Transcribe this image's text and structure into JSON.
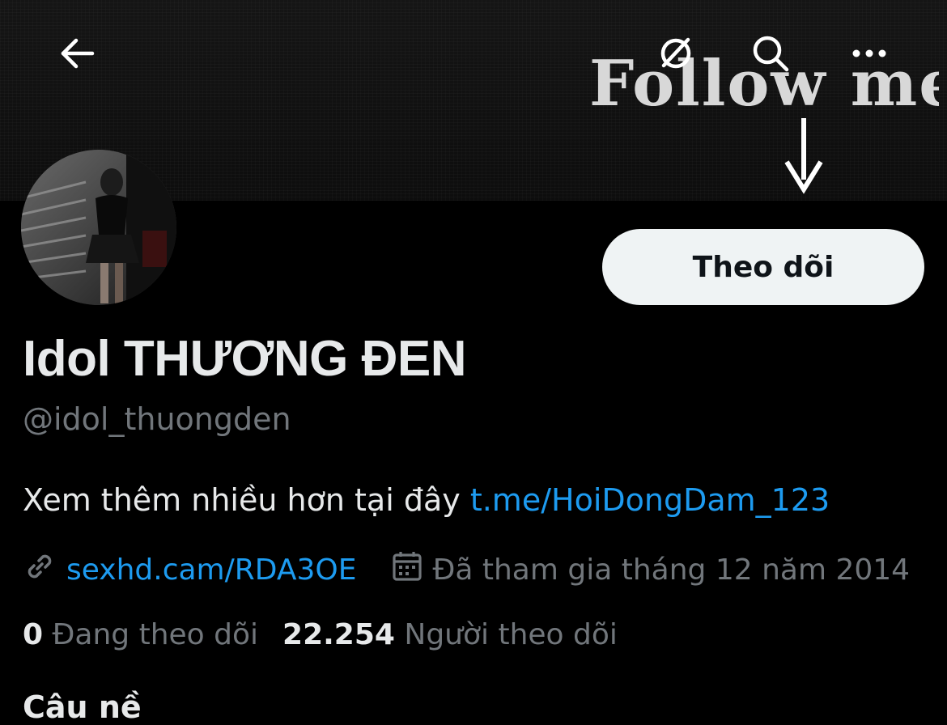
{
  "banner": {
    "text": "Follow me"
  },
  "header": {
    "back_icon": "arrow-left-icon",
    "grok_icon": "grok-icon",
    "search_icon": "search-icon",
    "more_icon": "more-dots-icon"
  },
  "profile": {
    "follow_label": "Theo dõi",
    "display_name": "Idol THƯƠNG ĐEN",
    "handle": "@idol_thuongden",
    "bio_text": "Xem thêm nhiều hơn tại đây ",
    "bio_link": "t.me/HoiDongDam_123",
    "website": "sexhd.cam/RDA3OE",
    "joined": "Đã tham gia tháng 12 năm 2014",
    "following_count": "0",
    "following_label": "Đang theo dõi",
    "followers_count": "22.254",
    "followers_label": "Người theo dõi",
    "cutoff_text": "Câu nề"
  },
  "colors": {
    "background": "#000000",
    "text_primary": "#e7e9ea",
    "text_secondary": "#71767b",
    "link": "#1d9bf0",
    "button_bg": "#eff3f4"
  }
}
